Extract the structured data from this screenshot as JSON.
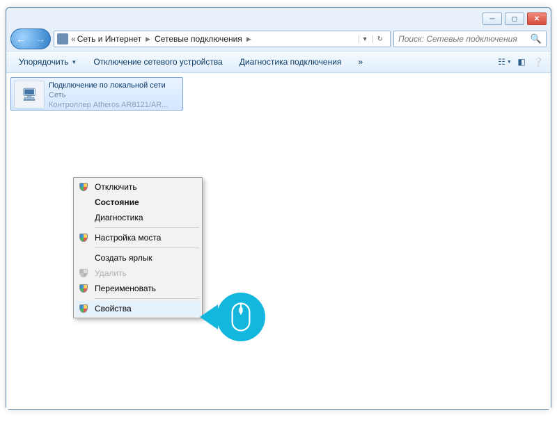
{
  "breadcrumb": {
    "seg1": "Сеть и Интернет",
    "seg2": "Сетевые подключения"
  },
  "search": {
    "placeholder": "Поиск: Сетевые подключения"
  },
  "toolbar": {
    "organize": "Упорядочить",
    "disable": "Отключение сетевого устройства",
    "diagnose": "Диагностика подключения",
    "overflow": "»"
  },
  "connection": {
    "title": "Подключение по локальной сети",
    "subtitle": "Сеть",
    "device": "Контроллер Atheros AR8121/AR..."
  },
  "context_menu": {
    "items": [
      {
        "label": "Отключить",
        "shield": true
      },
      {
        "label": "Состояние",
        "bold": true
      },
      {
        "label": "Диагностика"
      },
      {
        "sep": true
      },
      {
        "label": "Настройка моста",
        "shield": true
      },
      {
        "sep": true
      },
      {
        "label": "Создать ярлык"
      },
      {
        "label": "Удалить",
        "disabled": true,
        "shield_gray": true
      },
      {
        "label": "Переименовать",
        "shield": true
      },
      {
        "sep": true
      },
      {
        "label": "Свойства",
        "shield": true,
        "highlight": true
      }
    ]
  }
}
